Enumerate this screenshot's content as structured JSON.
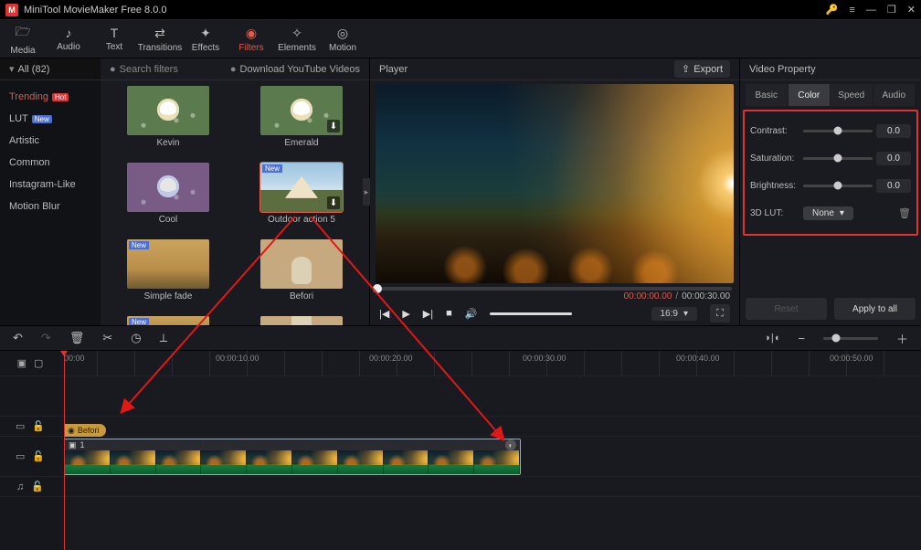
{
  "app": {
    "title": "MiniTool MovieMaker Free 8.0.0"
  },
  "toolbar_tabs": [
    {
      "label": "Media",
      "icon": "🗁"
    },
    {
      "label": "Audio",
      "icon": "♪"
    },
    {
      "label": "Text",
      "icon": "T"
    },
    {
      "label": "Transitions",
      "icon": "⇄"
    },
    {
      "label": "Effects",
      "icon": "✦"
    },
    {
      "label": "Filters",
      "icon": "◉"
    },
    {
      "label": "Elements",
      "icon": "✧"
    },
    {
      "label": "Motion",
      "icon": "◎"
    }
  ],
  "filters": {
    "all_label": "All (82)",
    "search_placeholder": "Search filters",
    "download_label": "Download YouTube Videos",
    "categories": [
      {
        "label": "Trending",
        "badge": "Hot"
      },
      {
        "label": "LUT",
        "badge": "New"
      },
      {
        "label": "Artistic"
      },
      {
        "label": "Common"
      },
      {
        "label": "Instagram-Like"
      },
      {
        "label": "Motion Blur"
      }
    ],
    "thumbs": [
      {
        "label": "Kevin",
        "badge": ""
      },
      {
        "label": "Emerald",
        "dl": true
      },
      {
        "label": "Cool"
      },
      {
        "label": "Outdoor action 5",
        "badge": "New",
        "dl": true,
        "selected": true,
        "style": "sky"
      },
      {
        "label": "Simple fade",
        "badge": "New",
        "style": "gold"
      },
      {
        "label": "Befori",
        "style": "portrait"
      },
      {
        "label": "",
        "badge": "New",
        "partial": true,
        "style": "gold"
      },
      {
        "label": "",
        "partial": true,
        "style": "portrait"
      }
    ]
  },
  "player": {
    "title": "Player",
    "export_label": "Export",
    "current": "00:00:00.00",
    "duration": "00:00:30.00",
    "aspect": "16:9"
  },
  "props": {
    "title": "Video Property",
    "tabs": [
      "Basic",
      "Color",
      "Speed",
      "Audio"
    ],
    "contrast_label": "Contrast:",
    "contrast_val": "0.0",
    "saturation_label": "Saturation:",
    "saturation_val": "0.0",
    "brightness_label": "Brightness:",
    "brightness_val": "0.0",
    "lut_label": "3D LUT:",
    "lut_value": "None",
    "reset": "Reset",
    "apply": "Apply to all"
  },
  "ruler": {
    "t0": "00:00",
    "t1": "00:00:10.00",
    "t2": "00:00:20.00",
    "t3": "00:00:30.00",
    "t4": "00:00:40.00",
    "t5": "00:00:50.00"
  },
  "timeline": {
    "filter_clip": "Befori",
    "clip_index": "1"
  }
}
